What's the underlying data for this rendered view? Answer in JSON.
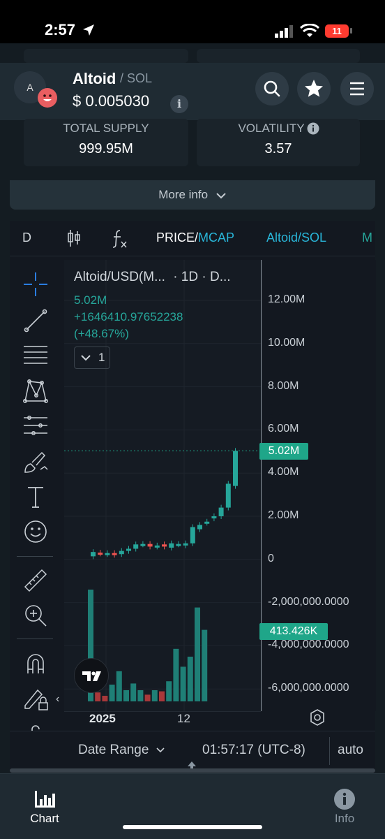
{
  "status_bar": {
    "time": "2:57",
    "battery": "11"
  },
  "header": {
    "avatar_letter": "A",
    "token_name": "Altoid",
    "pair_suffix": "/ SOL",
    "price": "$ 0.005030"
  },
  "stats": {
    "total_supply_label": "TOTAL SUPPLY",
    "total_supply_value": "999.95M",
    "volatility_label": "VOLATILITY",
    "volatility_value": "3.57"
  },
  "more_info": {
    "label": "More info"
  },
  "chart_toolbar": {
    "interval": "D",
    "price_label": "PRICE/",
    "mcap_label": "MCAP",
    "pair_label": "Altoid/SOL",
    "overflow_label": "M"
  },
  "legend": {
    "title": "Altoid/USD(M...",
    "meta": "· 1D · D...",
    "value": "5.02M",
    "change": "+1646410.97652238",
    "change_pct": "(+48.67%)",
    "collapse_count": "1"
  },
  "chart_data": {
    "type": "candlestick",
    "y_ticks": [
      "12.00M",
      "10.00M",
      "8.00M",
      "6.00M",
      "4.00M",
      "2.00M",
      "0",
      "-2,000,000.0000",
      "-4,000,000.0000",
      "-6,000,000.0000"
    ],
    "x_ticks": [
      "2025",
      "12"
    ],
    "last_value_label": "5.02M",
    "volume_label": "413.426K",
    "candles": [
      {
        "o": 0.15,
        "c": 0.35,
        "up": true
      },
      {
        "o": 0.32,
        "c": 0.28,
        "up": false
      },
      {
        "o": 0.25,
        "c": 0.3,
        "up": true
      },
      {
        "o": 0.3,
        "c": 0.22,
        "up": false
      },
      {
        "o": 0.25,
        "c": 0.4,
        "up": true
      },
      {
        "o": 0.4,
        "c": 0.5,
        "up": true
      },
      {
        "o": 0.5,
        "c": 0.7,
        "up": true
      },
      {
        "o": 0.7,
        "c": 0.72,
        "up": true
      },
      {
        "o": 0.72,
        "c": 0.6,
        "up": false
      },
      {
        "o": 0.6,
        "c": 0.65,
        "up": true
      },
      {
        "o": 0.7,
        "c": 0.6,
        "up": false
      },
      {
        "o": 0.55,
        "c": 0.75,
        "up": true
      },
      {
        "o": 0.7,
        "c": 0.72,
        "up": true
      },
      {
        "o": 0.65,
        "c": 0.75,
        "up": true
      },
      {
        "o": 0.75,
        "c": 1.5,
        "up": true
      },
      {
        "o": 1.4,
        "c": 1.6,
        "up": true
      },
      {
        "o": 1.7,
        "c": 1.75,
        "up": true
      },
      {
        "o": 1.9,
        "c": 2.0,
        "up": true
      },
      {
        "o": 2.0,
        "c": 2.4,
        "up": true
      },
      {
        "o": 2.4,
        "c": 3.5,
        "up": true
      },
      {
        "o": 3.4,
        "c": 5.02,
        "up": true
      }
    ],
    "volume": [
      {
        "v": 1.0,
        "up": true
      },
      {
        "v": 0.08,
        "up": false
      },
      {
        "v": 0.05,
        "up": false
      },
      {
        "v": 0.15,
        "up": true
      },
      {
        "v": 0.27,
        "up": true
      },
      {
        "v": 0.1,
        "up": true
      },
      {
        "v": 0.16,
        "up": true
      },
      {
        "v": 0.1,
        "up": true
      },
      {
        "v": 0.06,
        "up": false
      },
      {
        "v": 0.1,
        "up": true
      },
      {
        "v": 0.09,
        "up": false
      },
      {
        "v": 0.18,
        "up": true
      },
      {
        "v": 0.47,
        "up": true
      },
      {
        "v": 0.31,
        "up": true
      },
      {
        "v": 0.4,
        "up": true
      },
      {
        "v": 0.84,
        "up": true
      },
      {
        "v": 0.64,
        "up": true
      }
    ]
  },
  "bottom_bar": {
    "date_range": "Date Range",
    "clock": "01:57:17 (UTC-8)",
    "auto": "auto"
  },
  "tabs": {
    "chart": "Chart",
    "info": "Info"
  },
  "colors": {
    "up": "#26a69a",
    "down": "#ef5350",
    "accent": "#29b6d9",
    "price_tag": "#1fa689"
  }
}
